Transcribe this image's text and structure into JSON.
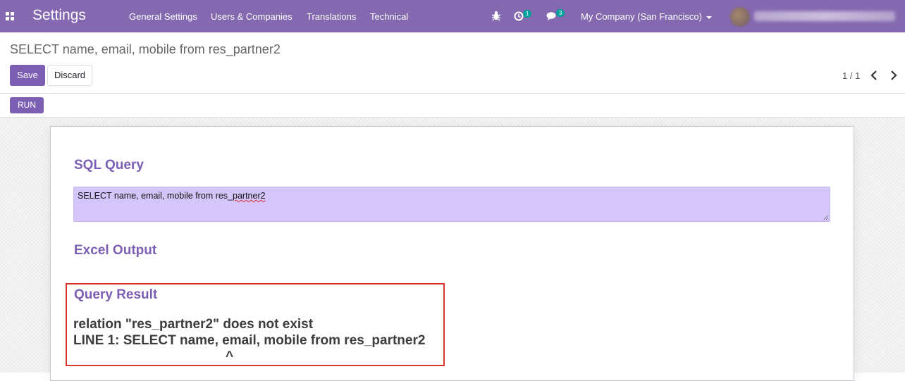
{
  "navbar": {
    "app_title": "Settings",
    "menu": [
      "General Settings",
      "Users & Companies",
      "Translations",
      "Technical"
    ],
    "activity_count": "1",
    "messages_count": "3",
    "company": "My Company (San Francisco)",
    "icons": [
      "apps-icon",
      "bug-icon",
      "clock-icon",
      "chat-icon",
      "chevron-down-icon"
    ]
  },
  "control_panel": {
    "breadcrumb": "SELECT name, email, mobile from res_partner2",
    "save_label": "Save",
    "discard_label": "Discard",
    "pager": "1 / 1",
    "run_label": "RUN"
  },
  "form": {
    "sql_query_label": "SQL Query",
    "sql_query_value": "SELECT name, email, mobile from res_",
    "sql_query_value_misspelled": "partner2",
    "excel_output_label": "Excel Output",
    "query_result_label": "Query Result",
    "error_line_1": "relation \"res_partner2\" does not exist",
    "error_line_2": "LINE 1: SELECT name, email, mobile from res_partner2",
    "error_line_3": "^"
  },
  "colors": {
    "navbar": "#8468b0",
    "accent": "#7c5fb3",
    "query_box": "#d4c5fa",
    "highlight_border": "#d9382f",
    "badge": "#00a09d"
  }
}
